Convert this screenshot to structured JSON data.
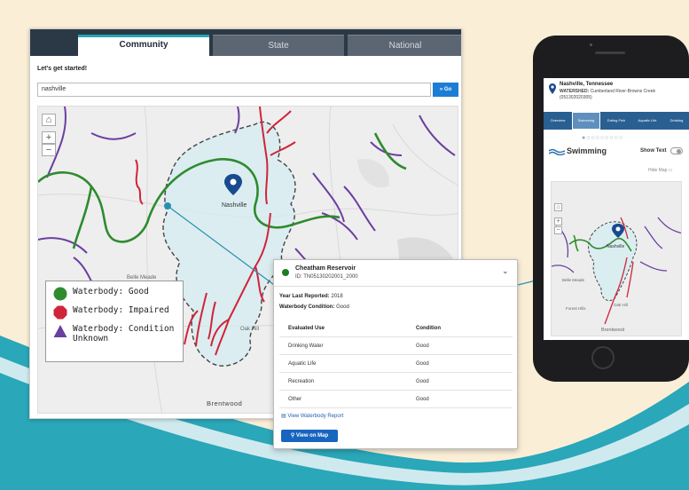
{
  "desktop": {
    "tabs": [
      "Community",
      "State",
      "National"
    ],
    "active_tab": "Community",
    "prompt": "Let's get started!",
    "search_value": "nashville",
    "go_label": "» Go",
    "map": {
      "city_label": "Nashville",
      "places": [
        "Belle Meade",
        "Oak Hill",
        "Brentwood"
      ],
      "legend": [
        {
          "label": "Waterbody: Good",
          "color": "#2e8b2e",
          "icon": "circle-icon"
        },
        {
          "label": "Waterbody: Impaired",
          "color": "#d0243a",
          "icon": "octagon-icon"
        },
        {
          "label": "Waterbody: Condition Unknown",
          "color": "#6a3fa0",
          "icon": "triangle-icon"
        }
      ]
    }
  },
  "popup": {
    "title": "Cheatham Reservoir",
    "id_line": "ID: TN05130202001_2000",
    "year_label": "Year Last Reported:",
    "year_value": "2018",
    "condition_label": "Waterbody Condition:",
    "condition_value": "Good",
    "headers": [
      "Evaluated Use",
      "Condition"
    ],
    "rows": [
      [
        "Drinking Water",
        "Good"
      ],
      [
        "Aquatic Life",
        "Good"
      ],
      [
        "Recreation",
        "Good"
      ],
      [
        "Other",
        "Good"
      ]
    ],
    "report_link": "View Waterbody Report",
    "map_button": "View on Map"
  },
  "phone": {
    "location": "Nashville, Tennessee",
    "watershed_label": "WATERSHED:",
    "watershed_value": "Cumberland River-Browns Creek (051302020305)",
    "tabs": [
      "Overview",
      "Swimming",
      "Eating Fish",
      "Aquatic Life",
      "Drinking"
    ],
    "active_tab": "Swimming",
    "section_title": "Swimming",
    "show_text": "Show Text",
    "hide_map": "Hide Map",
    "map_places": [
      "Nashville",
      "Belle Meade",
      "Forest Hills",
      "Oak Hill",
      "Brentwood"
    ]
  },
  "colors": {
    "accent": "#21a8b5",
    "good": "#2e8b2e",
    "impaired": "#d0243a",
    "unknown": "#6a3fa0",
    "button": "#1865bf"
  }
}
